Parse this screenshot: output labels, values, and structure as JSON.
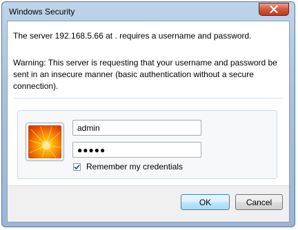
{
  "window": {
    "title": "Windows Security",
    "close_icon": "close-icon"
  },
  "message": {
    "server_prompt": "The server 192.168.5.66 at . requires a username and password.",
    "warning": "Warning: This server is requesting that your username and password be sent in an insecure manner (basic authentication without a secure connection)."
  },
  "credentials": {
    "avatar_icon": "flower-avatar-icon",
    "username_value": "admin",
    "password_value": "●●●●●",
    "remember_label": "Remember my credentials",
    "remember_checked": true
  },
  "buttons": {
    "ok_label": "OK",
    "cancel_label": "Cancel"
  },
  "colors": {
    "titlebar": "#a9c2de",
    "close_button": "#d4573a",
    "ok_button_border": "#3c7fb1"
  }
}
